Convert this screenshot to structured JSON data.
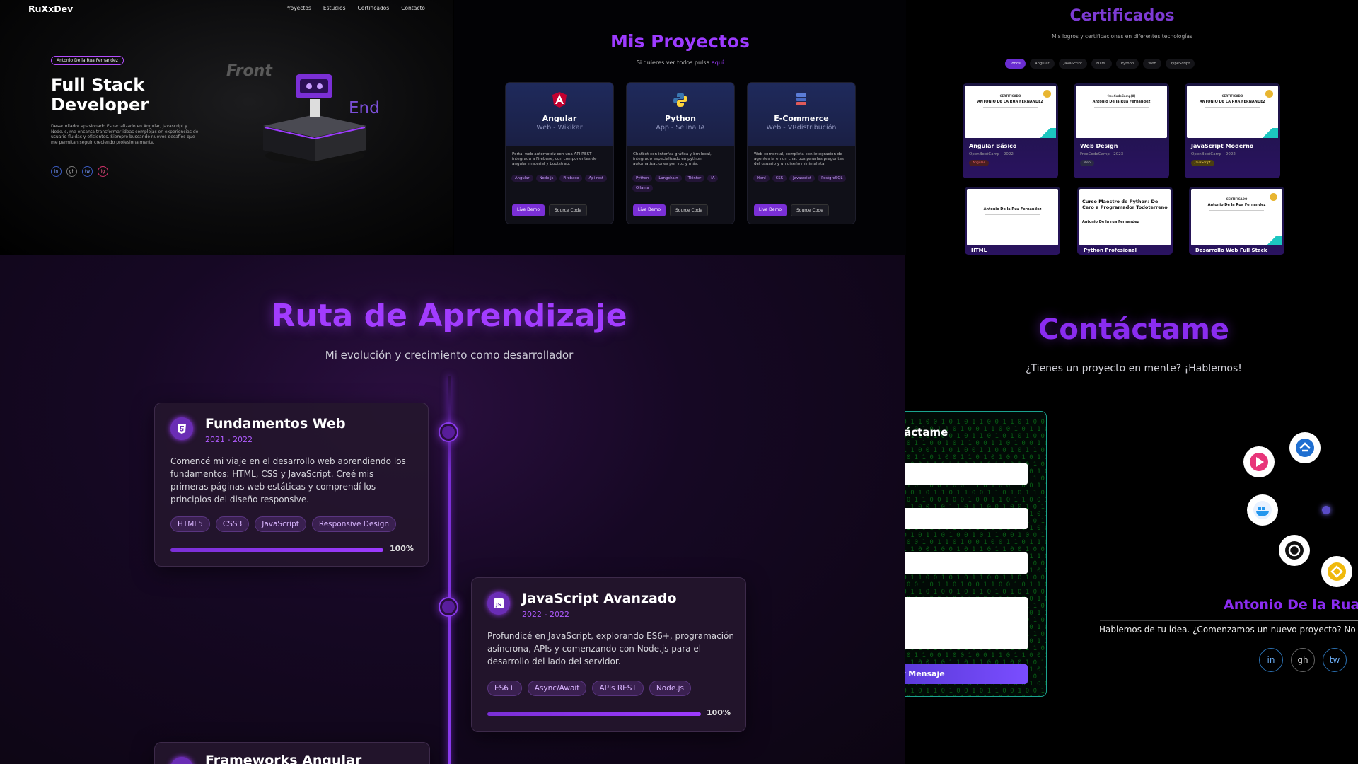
{
  "hero": {
    "brand": "RuXxDev",
    "nav": [
      "Proyectos",
      "Estudios",
      "Certificados",
      "Contacto"
    ],
    "badge": "Antonio De la Rua Fernandez",
    "title_line1": "Full Stack",
    "title_line2": "Developer",
    "description": "Desarrollador apasionado Especializado en Angular, Javascript y Node.js, me encanta transformar ideas complejas en experiencias de usuario fluidas y eficientes. Siempre buscando nuevos desafíos que me permitan seguir creciendo profesionalmente.",
    "front_label": "Front",
    "end_label": "End",
    "social": [
      "in",
      "gh",
      "tw",
      "ig"
    ]
  },
  "projects": {
    "title": "Mis Proyectos",
    "subtitle": "Si quieres ver todos pulsa",
    "subtitle_link": "aquí",
    "cards": [
      {
        "name": "Angular",
        "sub": "Web - Wikikar",
        "icon": "angular-icon",
        "desc": "Portal web automotriz con una API REST integrada a Firebase, con componentes de angular material y bootstrap.",
        "tags": [
          "Angular",
          "Node.js",
          "Firebase",
          "Api-rest"
        ],
        "live": "Live Demo",
        "source": "Source Code"
      },
      {
        "name": "Python",
        "sub": "App - Selina IA",
        "icon": "python-icon",
        "desc": "Chatbot con interfaz gráfica y bm local, integrado especializado en python, automatizaciones por voz y más.",
        "tags": [
          "Python",
          "Langchain",
          "Tkinter",
          "IA",
          "Ollama"
        ],
        "live": "Live Demo",
        "source": "Source Code"
      },
      {
        "name": "E-Commerce",
        "sub": "Web - VRdistribución",
        "icon": "database-icon",
        "desc": "Web comercial, completa con integracion de agentes ia en un chat bos para las preguntas del usuario y un diseño minimalista.",
        "tags": [
          "Html",
          "CSS",
          "Javascript",
          "PostgreSQL"
        ],
        "live": "Live Demo",
        "source": "Source Code"
      }
    ]
  },
  "certs": {
    "title": "Certificados",
    "subtitle": "Mis logros y certificaciones en diferentes tecnologías",
    "filters": [
      "Todos",
      "Angular",
      "JavaScript",
      "HTML",
      "Python",
      "Web",
      "TypeScript"
    ],
    "items": [
      {
        "name": "Angular Básico",
        "issuer": "OpenBootCamp - 2022",
        "tag": "Angular",
        "header": "CERTIFICADO",
        "holder": "ANTONIO DE LA RUA FERNANDEZ"
      },
      {
        "name": "Web Design",
        "issuer": "FreeCodeCamp - 2023",
        "tag": "Web",
        "header": "freeCodeCamp(A)",
        "holder": "Antonio De la Rua Fernandez"
      },
      {
        "name": "JavaScript Moderno",
        "issuer": "OpenBootCamp - 2022",
        "tag": "JavaScript",
        "header": "CERTIFICADO",
        "holder": "ANTONIO DE LA RUA FERNANDEZ"
      },
      {
        "name": "HTML",
        "issuer": "",
        "tag": "",
        "header": "",
        "holder": "Antonio De la Rua Fernandez"
      },
      {
        "name": "Python Profesional",
        "issuer": "",
        "tag": "",
        "header": "Curso Maestro de Python: De Cero a Programador Todoterreno",
        "holder": "Antonio De la rua Fernandez"
      },
      {
        "name": "Desarrollo Web Full Stack",
        "issuer": "",
        "tag": "",
        "header": "CERTIFICADO",
        "holder": "Antonio De la Rua Fernandez"
      }
    ]
  },
  "roadmap": {
    "title": "Ruta de Aprendizaje",
    "subtitle": "Mi evolución y crecimiento como desarrollador",
    "items": [
      {
        "title": "Fundamentos Web",
        "years": "2021 - 2022",
        "desc": "Comencé mi viaje en el desarrollo web aprendiendo los fundamentos: HTML, CSS y JavaScript. Creé mis primeras páginas web estáticas y comprendí los principios del diseño responsive.",
        "tags": [
          "HTML5",
          "CSS3",
          "JavaScript",
          "Responsive Design"
        ],
        "progress": 100,
        "progress_label": "100%"
      },
      {
        "title": "JavaScript Avanzado",
        "years": "2022 - 2022",
        "desc": "Profundicé en JavaScript, explorando ES6+, programación asíncrona, APIs y comenzando con Node.js para el desarrollo del lado del servidor.",
        "tags": [
          "ES6+",
          "Async/Await",
          "APIs REST",
          "Node.js"
        ],
        "progress": 100,
        "progress_label": "100%"
      },
      {
        "title": "Frameworks Angular"
      }
    ]
  },
  "contact": {
    "title": "Contáctame",
    "subtitle": "¿Tienes un proyecto en mente? ¡Hablemos!",
    "form_title": "táctame",
    "send": "r Mensaje",
    "name": "Antonio De la Rua F",
    "message": "Hablemos de tu idea. ¿Comenzamos un nuevo proyecto? No d",
    "social": [
      "in",
      "gh",
      "tw"
    ]
  }
}
